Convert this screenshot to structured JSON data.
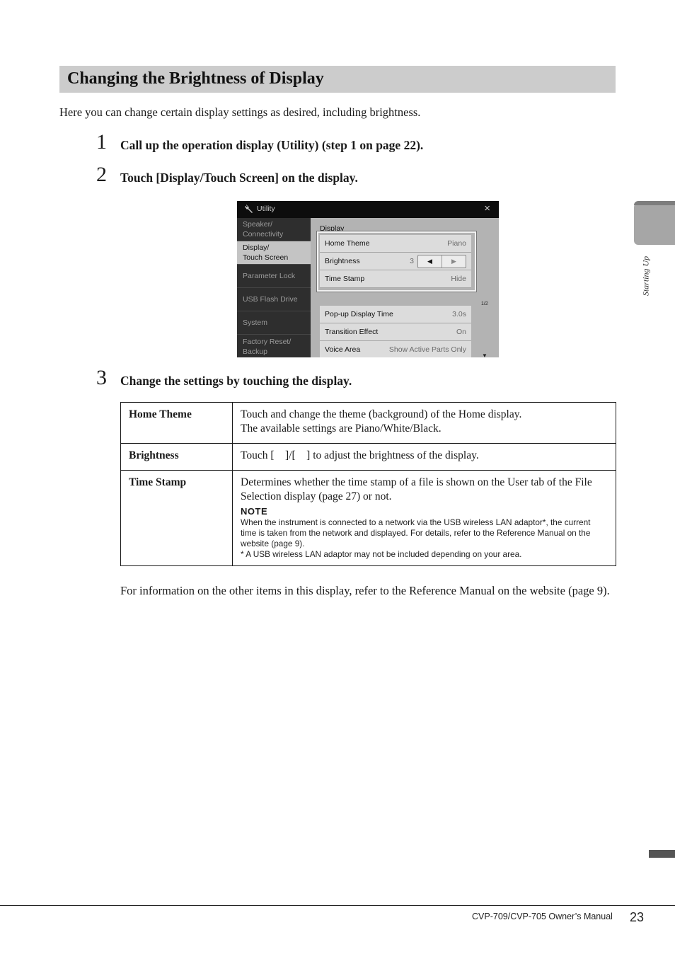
{
  "section": {
    "title": "Changing the Brightness of Display"
  },
  "intro": "Here you can change certain display settings as desired, including brightness.",
  "steps": [
    {
      "number": "1",
      "text": "Call up the operation display (Utility) (step 1 on page 22)."
    },
    {
      "number": "2",
      "text": "Touch [Display/Touch Screen] on the display."
    },
    {
      "number": "3",
      "text": "Change the settings by touching the display."
    }
  ],
  "screen": {
    "title": "Utility",
    "icon": "wrench-icon",
    "close": "×",
    "sidebar": [
      {
        "label": "Speaker/\nConnectivity",
        "active": false
      },
      {
        "label": "Display/\nTouch Screen",
        "active": true
      },
      {
        "label": "Parameter Lock",
        "active": false
      },
      {
        "label": "USB Flash Drive",
        "active": false
      },
      {
        "label": "System",
        "active": false
      },
      {
        "label": "Factory Reset/\nBackup",
        "active": false
      }
    ],
    "main_label": "Display",
    "rows": [
      {
        "label": "Home Theme",
        "value": "Piano"
      },
      {
        "label": "Brightness",
        "value": "3",
        "left_arrow": "◀",
        "right_arrow": "▶"
      },
      {
        "label": "Time Stamp",
        "value": "Hide"
      },
      {
        "label": "Pop-up Display Time",
        "value": "3.0s"
      },
      {
        "label": "Transition Effect",
        "value": "On"
      },
      {
        "label": "Voice Area",
        "value": "Show Active Parts Only"
      }
    ],
    "page_indicator": "1/2",
    "scroll_down": "▼"
  },
  "table": [
    {
      "key": "Home Theme",
      "lines": [
        "Touch and change the theme (background) of the Home display.",
        "The available settings are Piano/White/Black."
      ]
    },
    {
      "key": "Brightness",
      "lines": [
        "Touch [    ]/[    ] to adjust the brightness of the display."
      ]
    },
    {
      "key": "Time Stamp",
      "lines": [
        "Determines whether the time stamp of a file is shown on the User tab of the File Selection display (page 27) or not."
      ],
      "note_heading": "NOTE",
      "note_lines": [
        "When the instrument is connected to a network via the USB wireless LAN adaptor*, the current time is taken from the network and displayed. For details, refer to the Reference Manual on the website (page 9).",
        "* A USB wireless LAN adaptor may not be included depending on your area."
      ]
    }
  ],
  "outro": "For information on the other items in this display, refer to the Reference Manual on the website (page 9).",
  "side_tab_label": "Starting Up",
  "footer": {
    "manual": "CVP-709/CVP-705 Owner’s Manual",
    "page": "23"
  }
}
